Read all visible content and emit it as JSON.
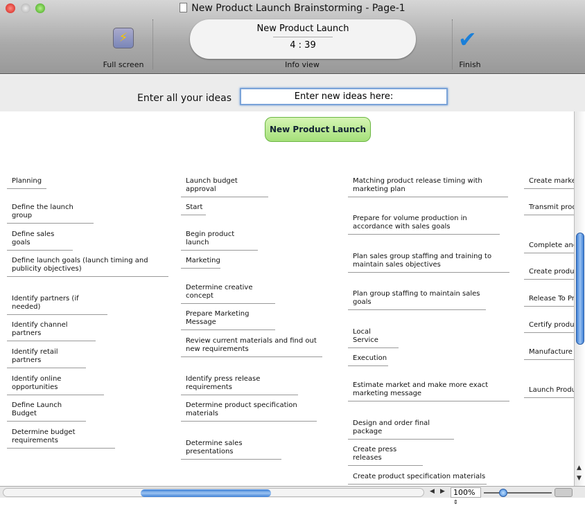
{
  "window": {
    "title": "New Product Launch Brainstorming - Page-1"
  },
  "toolbar": {
    "fullscreen_label": "Full screen",
    "info_label": "Info view",
    "finish_label": "Finish",
    "info_title": "New Product Launch",
    "info_timer": "4 : 39"
  },
  "entry": {
    "label": "Enter all your ideas",
    "value": "Enter new ideas here:"
  },
  "root_node": "New Product Launch",
  "columns": [
    [
      "Planning",
      "Define the launch group",
      "Define sales goals",
      "Define launch goals (launch timing and publicity objectives)",
      "Identify partners (if needed)",
      "Identify channel partners",
      "Identify retail partners",
      "Identify online opportunities",
      "Define Launch Budget",
      "Determine budget requirements"
    ],
    [
      "Launch budget approval",
      "Start",
      "Begin product launch",
      "Marketing",
      "Determine creative concept",
      "Prepare Marketing Message",
      "Review current materials and find out new requirements",
      "Identify press release requirements",
      "Determine product specification materials",
      "Determine sales presentations"
    ],
    [
      "Matching product release timing with marketing plan",
      "Prepare for volume production in accordance with sales goals",
      "Plan sales group staffing and training to maintain sales objectives",
      "Plan group staffing to maintain sales goals",
      "Local Service",
      "Execution",
      "Estimate market and make more exact marketing message",
      "Design and order final package",
      "Create press releases",
      "Create product specification materials"
    ],
    [
      "Create marketi",
      "Transmit produ organization",
      "Complete and t",
      "Create product",
      "Release To Pro",
      "Certify product",
      "Manufacture th meet sales goal",
      "Launch Produc"
    ]
  ],
  "zoom": "100%"
}
